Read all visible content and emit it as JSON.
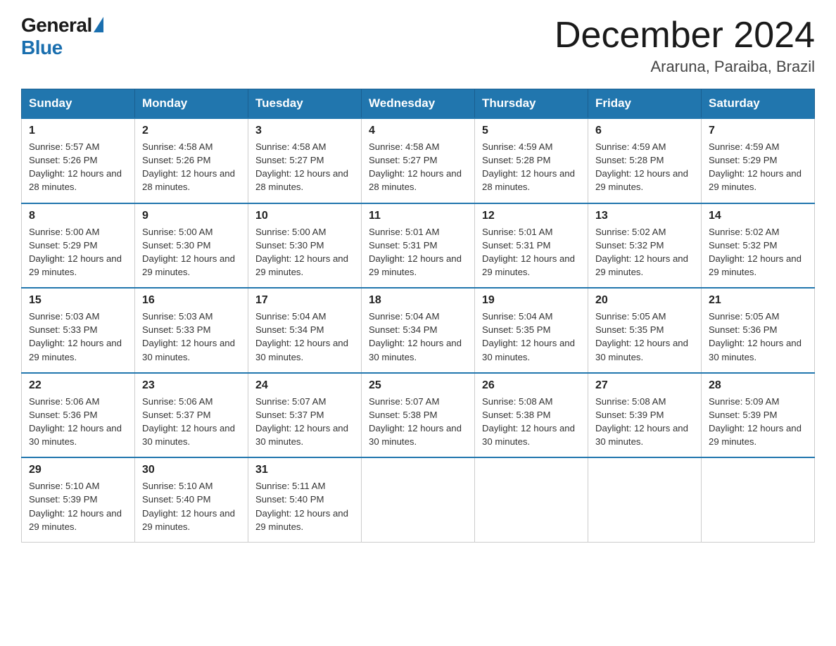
{
  "logo": {
    "general": "General",
    "blue": "Blue"
  },
  "title": "December 2024",
  "location": "Araruna, Paraiba, Brazil",
  "days_of_week": [
    "Sunday",
    "Monday",
    "Tuesday",
    "Wednesday",
    "Thursday",
    "Friday",
    "Saturday"
  ],
  "weeks": [
    [
      {
        "day": "1",
        "sunrise": "5:57 AM",
        "sunset": "5:26 PM",
        "daylight": "12 hours and 28 minutes."
      },
      {
        "day": "2",
        "sunrise": "4:58 AM",
        "sunset": "5:26 PM",
        "daylight": "12 hours and 28 minutes."
      },
      {
        "day": "3",
        "sunrise": "4:58 AM",
        "sunset": "5:27 PM",
        "daylight": "12 hours and 28 minutes."
      },
      {
        "day": "4",
        "sunrise": "4:58 AM",
        "sunset": "5:27 PM",
        "daylight": "12 hours and 28 minutes."
      },
      {
        "day": "5",
        "sunrise": "4:59 AM",
        "sunset": "5:28 PM",
        "daylight": "12 hours and 28 minutes."
      },
      {
        "day": "6",
        "sunrise": "4:59 AM",
        "sunset": "5:28 PM",
        "daylight": "12 hours and 29 minutes."
      },
      {
        "day": "7",
        "sunrise": "4:59 AM",
        "sunset": "5:29 PM",
        "daylight": "12 hours and 29 minutes."
      }
    ],
    [
      {
        "day": "8",
        "sunrise": "5:00 AM",
        "sunset": "5:29 PM",
        "daylight": "12 hours and 29 minutes."
      },
      {
        "day": "9",
        "sunrise": "5:00 AM",
        "sunset": "5:30 PM",
        "daylight": "12 hours and 29 minutes."
      },
      {
        "day": "10",
        "sunrise": "5:00 AM",
        "sunset": "5:30 PM",
        "daylight": "12 hours and 29 minutes."
      },
      {
        "day": "11",
        "sunrise": "5:01 AM",
        "sunset": "5:31 PM",
        "daylight": "12 hours and 29 minutes."
      },
      {
        "day": "12",
        "sunrise": "5:01 AM",
        "sunset": "5:31 PM",
        "daylight": "12 hours and 29 minutes."
      },
      {
        "day": "13",
        "sunrise": "5:02 AM",
        "sunset": "5:32 PM",
        "daylight": "12 hours and 29 minutes."
      },
      {
        "day": "14",
        "sunrise": "5:02 AM",
        "sunset": "5:32 PM",
        "daylight": "12 hours and 29 minutes."
      }
    ],
    [
      {
        "day": "15",
        "sunrise": "5:03 AM",
        "sunset": "5:33 PM",
        "daylight": "12 hours and 29 minutes."
      },
      {
        "day": "16",
        "sunrise": "5:03 AM",
        "sunset": "5:33 PM",
        "daylight": "12 hours and 30 minutes."
      },
      {
        "day": "17",
        "sunrise": "5:04 AM",
        "sunset": "5:34 PM",
        "daylight": "12 hours and 30 minutes."
      },
      {
        "day": "18",
        "sunrise": "5:04 AM",
        "sunset": "5:34 PM",
        "daylight": "12 hours and 30 minutes."
      },
      {
        "day": "19",
        "sunrise": "5:04 AM",
        "sunset": "5:35 PM",
        "daylight": "12 hours and 30 minutes."
      },
      {
        "day": "20",
        "sunrise": "5:05 AM",
        "sunset": "5:35 PM",
        "daylight": "12 hours and 30 minutes."
      },
      {
        "day": "21",
        "sunrise": "5:05 AM",
        "sunset": "5:36 PM",
        "daylight": "12 hours and 30 minutes."
      }
    ],
    [
      {
        "day": "22",
        "sunrise": "5:06 AM",
        "sunset": "5:36 PM",
        "daylight": "12 hours and 30 minutes."
      },
      {
        "day": "23",
        "sunrise": "5:06 AM",
        "sunset": "5:37 PM",
        "daylight": "12 hours and 30 minutes."
      },
      {
        "day": "24",
        "sunrise": "5:07 AM",
        "sunset": "5:37 PM",
        "daylight": "12 hours and 30 minutes."
      },
      {
        "day": "25",
        "sunrise": "5:07 AM",
        "sunset": "5:38 PM",
        "daylight": "12 hours and 30 minutes."
      },
      {
        "day": "26",
        "sunrise": "5:08 AM",
        "sunset": "5:38 PM",
        "daylight": "12 hours and 30 minutes."
      },
      {
        "day": "27",
        "sunrise": "5:08 AM",
        "sunset": "5:39 PM",
        "daylight": "12 hours and 30 minutes."
      },
      {
        "day": "28",
        "sunrise": "5:09 AM",
        "sunset": "5:39 PM",
        "daylight": "12 hours and 29 minutes."
      }
    ],
    [
      {
        "day": "29",
        "sunrise": "5:10 AM",
        "sunset": "5:39 PM",
        "daylight": "12 hours and 29 minutes."
      },
      {
        "day": "30",
        "sunrise": "5:10 AM",
        "sunset": "5:40 PM",
        "daylight": "12 hours and 29 minutes."
      },
      {
        "day": "31",
        "sunrise": "5:11 AM",
        "sunset": "5:40 PM",
        "daylight": "12 hours and 29 minutes."
      },
      null,
      null,
      null,
      null
    ]
  ]
}
